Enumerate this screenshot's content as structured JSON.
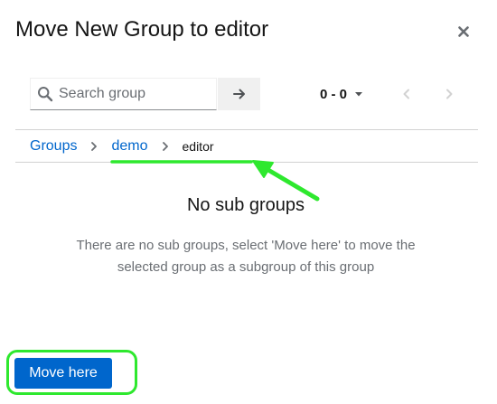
{
  "modal": {
    "title": "Move New Group to editor",
    "close_icon": "close-icon"
  },
  "toolbar": {
    "search_placeholder": "Search group",
    "search_value": "",
    "go_icon": "arrow-right-icon",
    "pagination_label": "0 - 0",
    "pagination_toggle_icon": "caret-down-icon",
    "prev_icon": "chevron-left-icon",
    "next_icon": "chevron-right-icon"
  },
  "breadcrumb": {
    "items": [
      {
        "label": "Groups"
      },
      {
        "label": "demo"
      },
      {
        "label": "editor"
      }
    ]
  },
  "empty_state": {
    "title": "No sub groups",
    "body": "There are no sub groups, select 'Move here' to move the selected group as a subgroup of this group"
  },
  "footer": {
    "move_label": "Move here"
  },
  "colors": {
    "accent": "#0066cc",
    "annotation": "#2ee82e"
  }
}
